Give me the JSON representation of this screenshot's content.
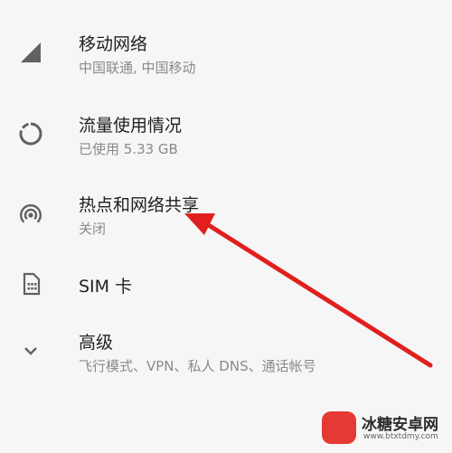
{
  "settings": {
    "mobile_network": {
      "title": "移动网络",
      "subtitle": "中国联通, 中国移动",
      "icon": "signal-icon"
    },
    "data_usage": {
      "title": "流量使用情况",
      "subtitle": "已使用 5.33 GB",
      "icon": "data-usage-icon"
    },
    "hotspot": {
      "title": "热点和网络共享",
      "subtitle": "关闭",
      "icon": "hotspot-icon"
    },
    "sim": {
      "title": "SIM 卡",
      "icon": "sim-card-icon"
    },
    "advanced": {
      "title": "高级",
      "subtitle": "飞行模式、VPN、私人 DNS、通话帐号",
      "icon": "chevron-down-icon"
    }
  },
  "watermark": {
    "name": "冰糖安卓网",
    "url": "www.btxtdmy.com"
  },
  "colors": {
    "background": "#f6f6f6",
    "icon": "#616161",
    "arrow": "#e0201e"
  }
}
